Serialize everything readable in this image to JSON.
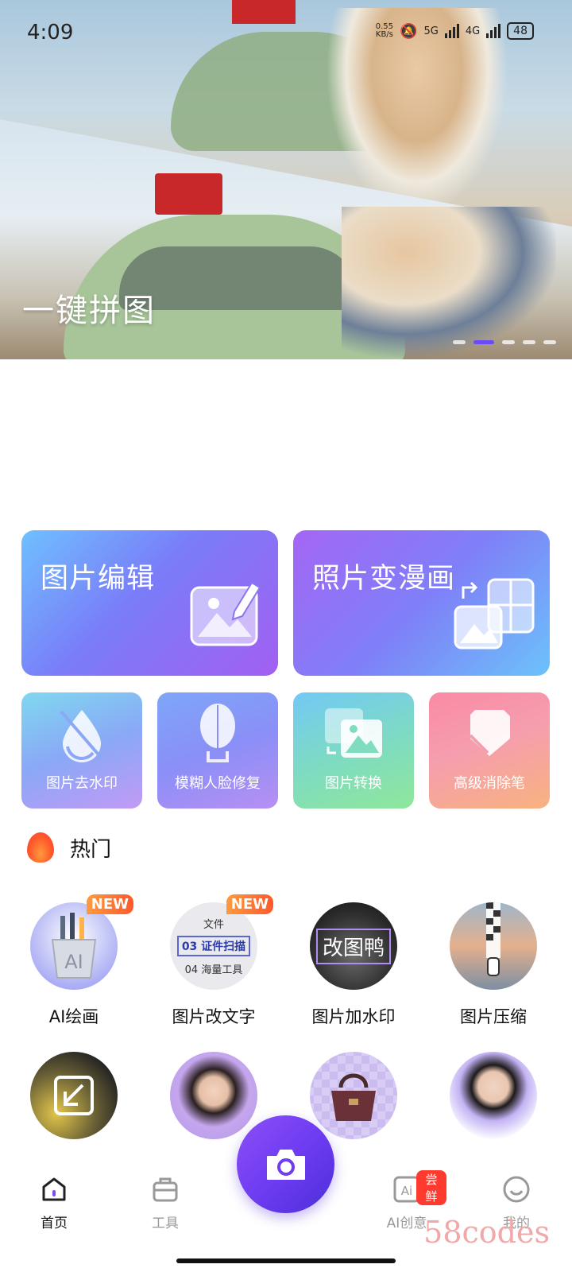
{
  "status": {
    "time": "4:09",
    "net_speed_value": "0.55",
    "net_speed_unit": "KB/s",
    "signal_1": "5G",
    "signal_2": "4G",
    "battery": "48"
  },
  "banner": {
    "title": "一键拼图",
    "slide_count": 5,
    "active_slide": 2
  },
  "features": {
    "big": [
      {
        "label": "图片编辑",
        "icon": "photo-edit-icon"
      },
      {
        "label": "照片变漫画",
        "icon": "comic-grid-icon"
      }
    ],
    "small": [
      {
        "label": "图片去水印",
        "icon": "watermark-remove-icon"
      },
      {
        "label": "模糊人脸修复",
        "icon": "face-restore-icon"
      },
      {
        "label": "图片转换",
        "icon": "image-convert-icon"
      },
      {
        "label": "高级消除笔",
        "icon": "eraser-icon"
      }
    ]
  },
  "hot": {
    "title": "热门",
    "items": [
      {
        "label": "AI绘画",
        "badge": "NEW"
      },
      {
        "label": "图片改文字",
        "badge": "NEW",
        "thumb_lines": [
          "文件",
          "03 证件扫描",
          "04 海量工具"
        ]
      },
      {
        "label": "图片加水印",
        "thumb_text": "改图鸭"
      },
      {
        "label": "图片压缩"
      }
    ],
    "row2_thumbs": [
      "resize-thumb",
      "portrait-thumb",
      "bag-thumb",
      "id-photo-thumb"
    ]
  },
  "tabbar": {
    "tabs": [
      {
        "label": "首页",
        "icon": "home-icon"
      },
      {
        "label": "工具",
        "icon": "toolbox-icon"
      },
      {
        "label": "AI创意",
        "icon": "ai-icon",
        "badge": "尝鲜"
      },
      {
        "label": "我的",
        "icon": "smiley-icon"
      }
    ],
    "camera_icon": "camera-icon"
  },
  "watermark": "58codes",
  "colors": {
    "accent": "#6a4cf5",
    "hot_badge": "#ff5a2b",
    "tab_badge": "#ff3b30"
  }
}
